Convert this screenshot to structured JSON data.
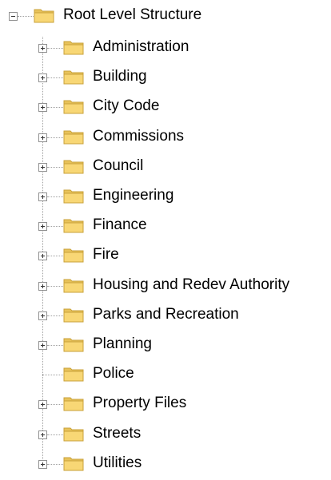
{
  "tree": {
    "root": {
      "label": "Root Level Structure",
      "icon": "folder-icon",
      "expanded": true
    },
    "children": [
      {
        "label": "Administration",
        "has_children": true
      },
      {
        "label": "Building",
        "has_children": true
      },
      {
        "label": "City Code",
        "has_children": true
      },
      {
        "label": "Commissions",
        "has_children": true
      },
      {
        "label": "Council",
        "has_children": true
      },
      {
        "label": "Engineering",
        "has_children": true
      },
      {
        "label": "Finance",
        "has_children": true
      },
      {
        "label": "Fire",
        "has_children": true
      },
      {
        "label": "Housing and Redev Authority",
        "has_children": true
      },
      {
        "label": "Parks and Recreation",
        "has_children": true
      },
      {
        "label": "Planning",
        "has_children": true
      },
      {
        "label": "Police",
        "has_children": false
      },
      {
        "label": "Property Files",
        "has_children": true
      },
      {
        "label": "Streets",
        "has_children": true
      },
      {
        "label": "Utilities",
        "has_children": true
      }
    ]
  },
  "colors": {
    "folder_fill": "#f8d775",
    "folder_tab": "#e8c25a",
    "folder_outline": "#c9a13a",
    "connector": "#a0a0a0"
  }
}
